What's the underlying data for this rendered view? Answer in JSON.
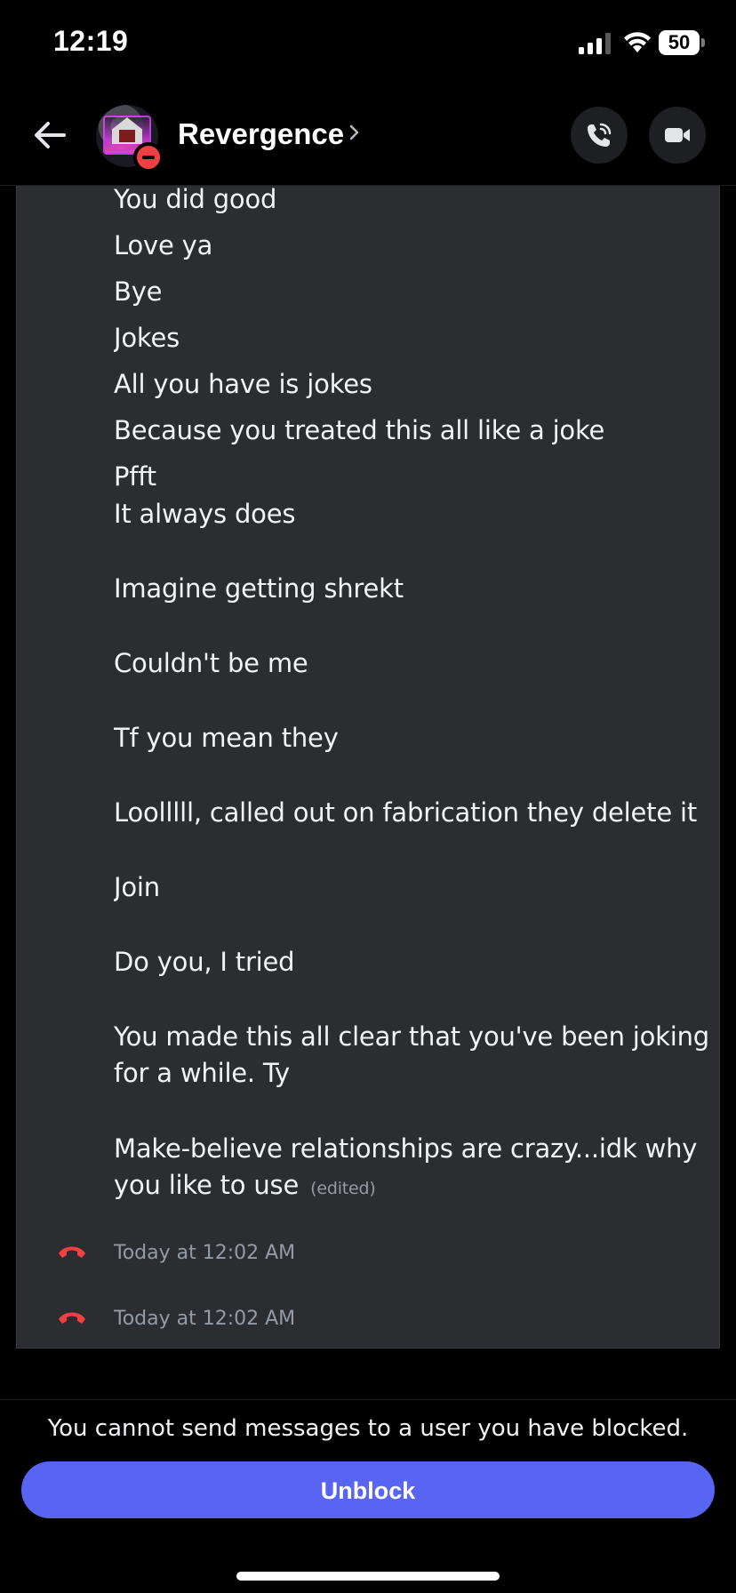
{
  "status_bar": {
    "time": "12:19",
    "battery": "50"
  },
  "header": {
    "channel_name": "Revergence",
    "chevron": "chevron-right-icon",
    "call_icon": "phone-call-icon",
    "video_icon": "video-camera-icon"
  },
  "messages": [
    "You did good",
    "Love ya",
    "Bye",
    "Jokes",
    "All you have is jokes",
    "Because you treated this all like a joke",
    "Pfft",
    "It always does",
    "Imagine getting shrekt",
    "Couldn't be me",
    "Tf you mean they",
    "Loolllll, called out on fabrication they delete it",
    "Join",
    "Do you, I tried",
    "You made this all clear that you've been joking for a while. Ty",
    "Make-believe relationships are crazy...idk why you like to use"
  ],
  "edited_label": "(edited)",
  "calls": [
    {
      "time": "Today at 12:02 AM",
      "icon": "missed-call-icon",
      "color": "#f23f43"
    },
    {
      "time": "Today at 12:02 AM",
      "icon": "missed-call-icon",
      "color": "#f23f43"
    }
  ],
  "footer": {
    "blocked_text": "You cannot send messages to a user you have blocked.",
    "unblock_label": "Unblock"
  },
  "colors": {
    "background": "#000000",
    "panel": "#2b2d31",
    "accent": "#5865f2",
    "danger": "#f23f43",
    "muted_text": "#949ba4"
  }
}
